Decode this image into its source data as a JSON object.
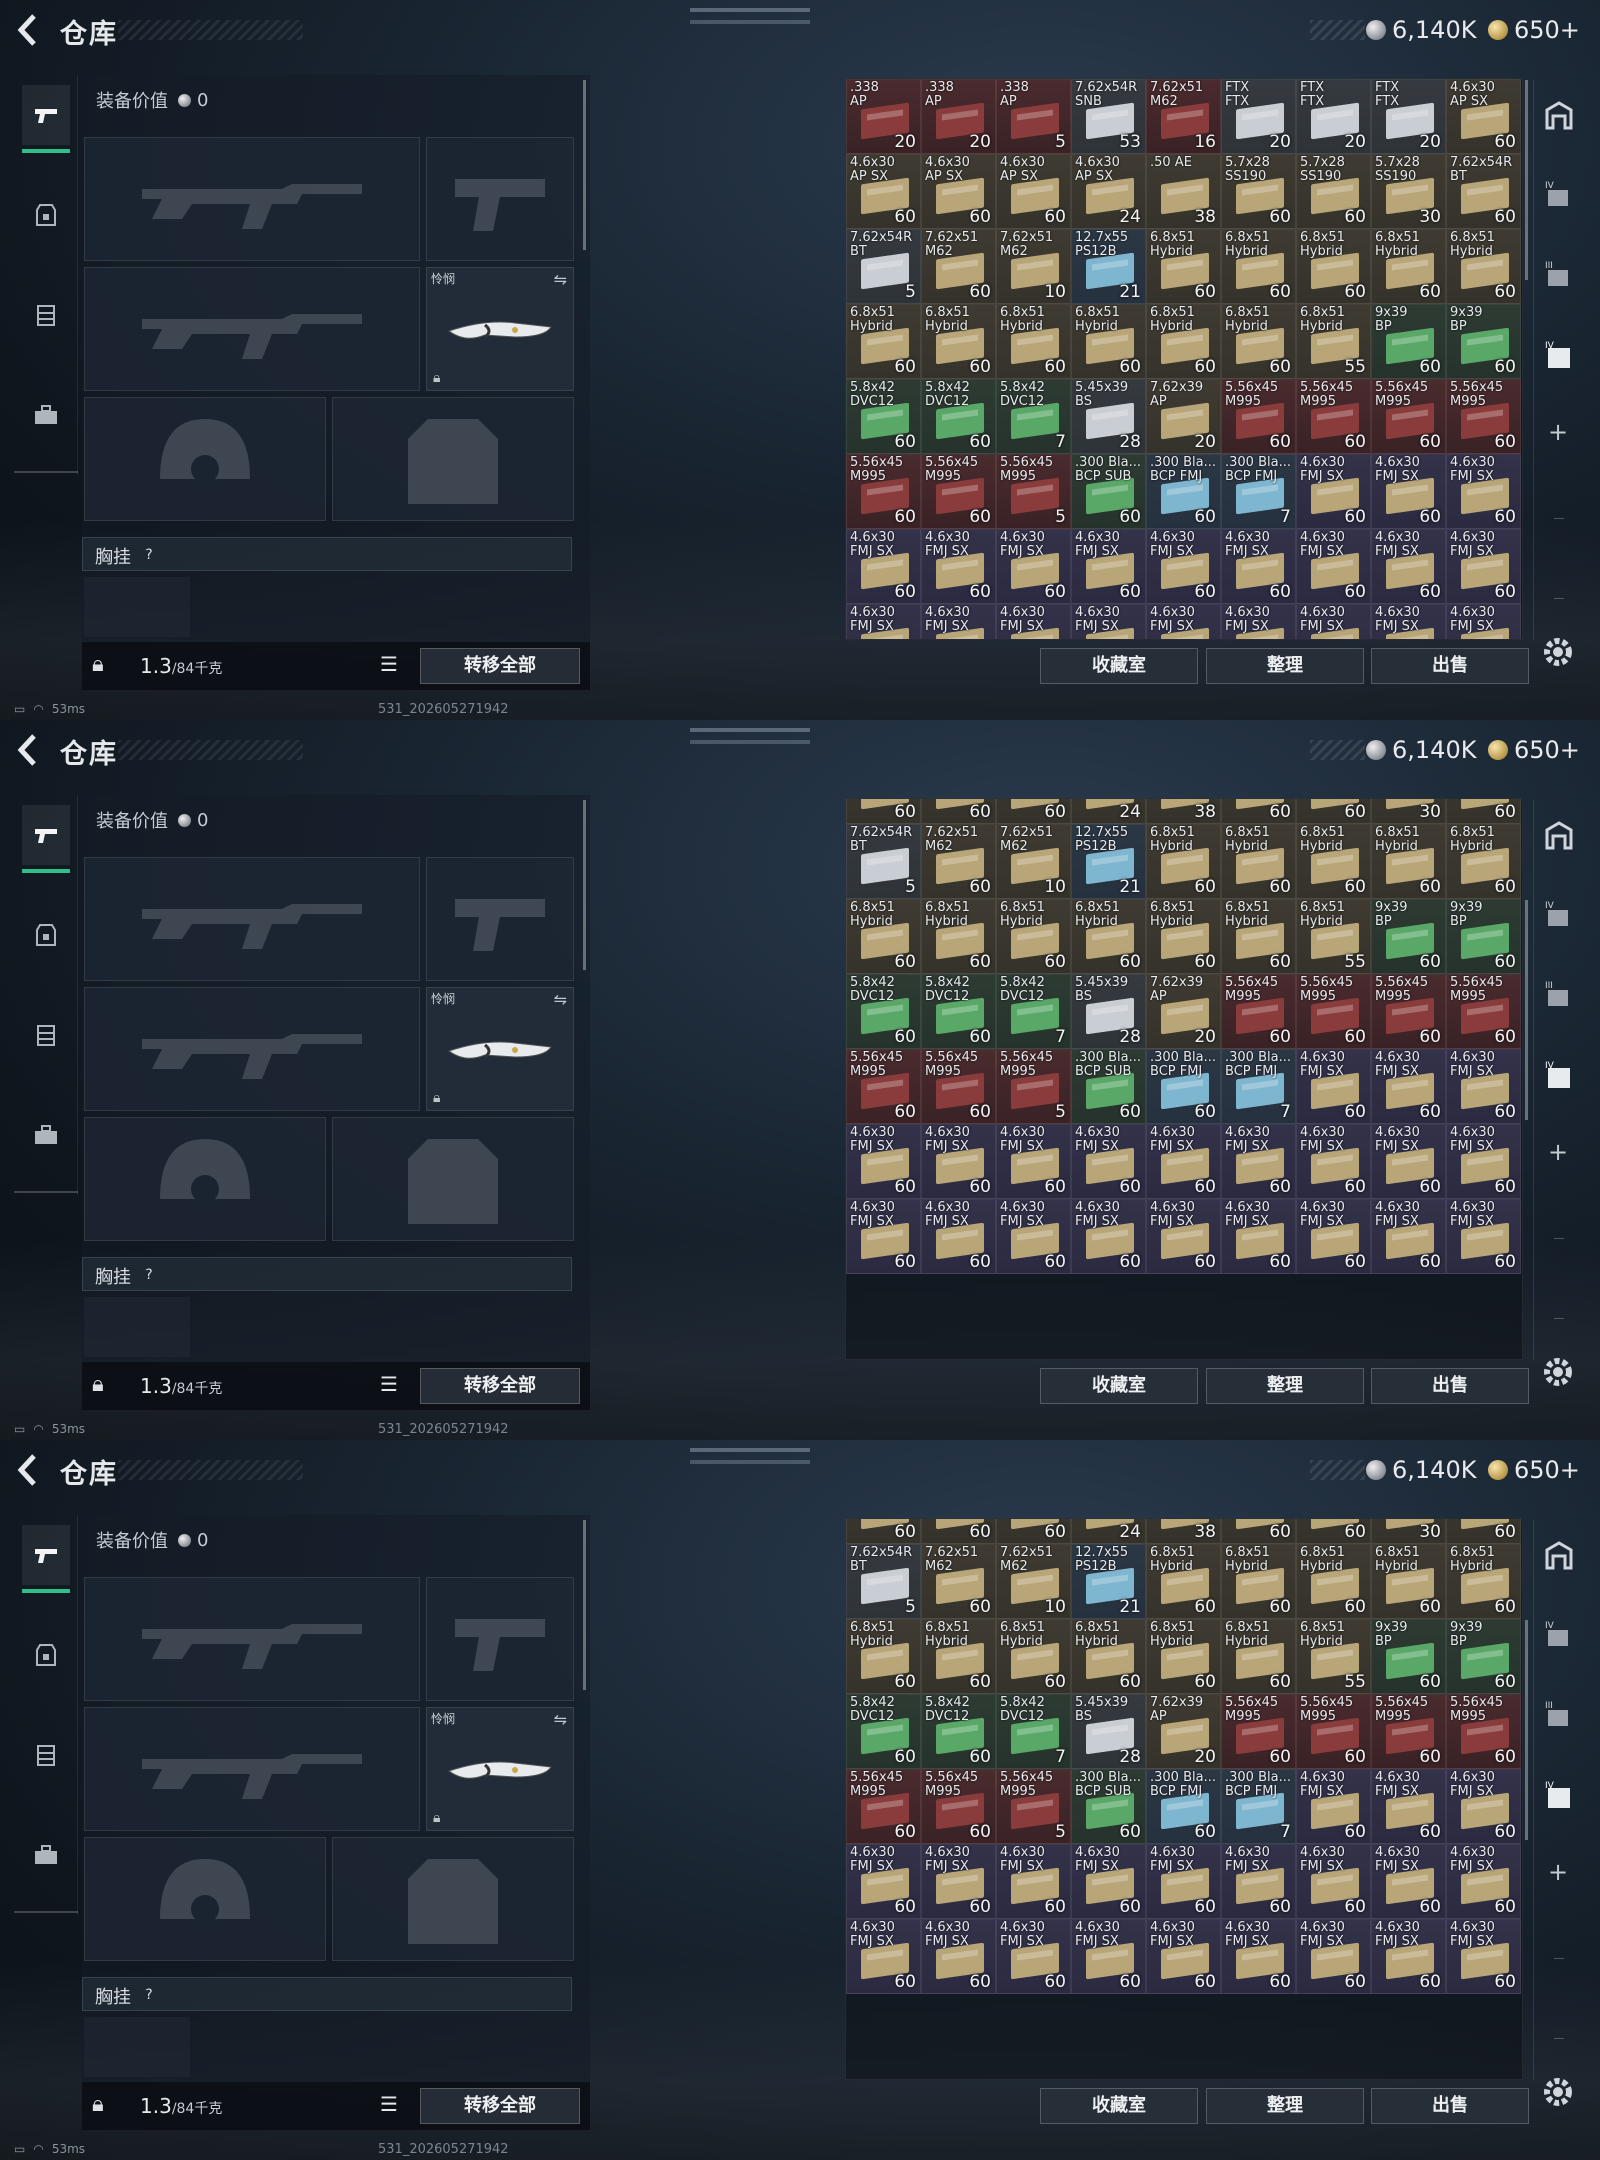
{
  "page": {
    "title": "仓库"
  },
  "currency": {
    "silver": "6,140K",
    "gold": "650+"
  },
  "loadout": {
    "value_label": "装备价值",
    "value": "0",
    "knife_label": "怜悯",
    "chest_label": "胸挂",
    "chest_help": "?",
    "weight": "1.3",
    "weight_max": "/84千克",
    "transfer_all": "转移全部"
  },
  "stash": {
    "collection": "收藏室",
    "sort": "整理",
    "sell": "出售"
  },
  "status": {
    "ping": "53ms",
    "build": "531_202605271942"
  },
  "rows": [
    [
      [
        "red",
        ".338",
        "AP",
        "20"
      ],
      [
        "red",
        ".338",
        "AP",
        "20"
      ],
      [
        "red",
        ".338",
        "AP",
        "5"
      ],
      [
        "g",
        "7.62x54R",
        "SNB",
        "53"
      ],
      [
        "red",
        "7.62x51",
        "M62",
        "16"
      ],
      [
        "g",
        "FTX",
        "FTX",
        "20"
      ],
      [
        "g",
        "FTX",
        "FTX",
        "20"
      ],
      [
        "g",
        "FTX",
        "FTX",
        "20"
      ],
      [
        "y",
        "4.6x30",
        "AP SX",
        "60"
      ]
    ],
    [
      [
        "y",
        "4.6x30",
        "AP SX",
        "60"
      ],
      [
        "y",
        "4.6x30",
        "AP SX",
        "60"
      ],
      [
        "y",
        "4.6x30",
        "AP SX",
        "60"
      ],
      [
        "y",
        "4.6x30",
        "AP SX",
        "24"
      ],
      [
        "y",
        ".50 AE",
        "",
        "38"
      ],
      [
        "y",
        "5.7x28",
        "SS190",
        "60"
      ],
      [
        "y",
        "5.7x28",
        "SS190",
        "60"
      ],
      [
        "y",
        "5.7x28",
        "SS190",
        "30"
      ],
      [
        "y",
        "7.62x54R",
        "BT",
        "60"
      ]
    ],
    [
      [
        "g",
        "7.62x54R",
        "BT",
        "5"
      ],
      [
        "y",
        "7.62x51",
        "M62",
        "60"
      ],
      [
        "y",
        "7.62x51",
        "M62",
        "10"
      ],
      [
        "b",
        "12.7x55",
        "PS12B",
        "21"
      ],
      [
        "y",
        "6.8x51",
        "Hybrid",
        "60"
      ],
      [
        "y",
        "6.8x51",
        "Hybrid",
        "60"
      ],
      [
        "y",
        "6.8x51",
        "Hybrid",
        "60"
      ],
      [
        "y",
        "6.8x51",
        "Hybrid",
        "60"
      ],
      [
        "y",
        "6.8x51",
        "Hybrid",
        "60"
      ]
    ],
    [
      [
        "y",
        "6.8x51",
        "Hybrid",
        "60"
      ],
      [
        "y",
        "6.8x51",
        "Hybrid",
        "60"
      ],
      [
        "y",
        "6.8x51",
        "Hybrid",
        "60"
      ],
      [
        "y",
        "6.8x51",
        "Hybrid",
        "60"
      ],
      [
        "y",
        "6.8x51",
        "Hybrid",
        "60"
      ],
      [
        "y",
        "6.8x51",
        "Hybrid",
        "60"
      ],
      [
        "y",
        "6.8x51",
        "Hybrid",
        "55"
      ],
      [
        "gr",
        "9x39",
        "BP",
        "60"
      ],
      [
        "gr",
        "9x39",
        "BP",
        "60"
      ]
    ],
    [
      [
        "gr",
        "5.8x42",
        "DVC12",
        "60"
      ],
      [
        "gr",
        "5.8x42",
        "DVC12",
        "60"
      ],
      [
        "gr",
        "5.8x42",
        "DVC12",
        "7"
      ],
      [
        "g",
        "5.45x39",
        "BS",
        "28"
      ],
      [
        "y",
        "7.62x39",
        "AP",
        "20"
      ],
      [
        "red",
        "5.56x45",
        "M995",
        "60"
      ],
      [
        "red",
        "5.56x45",
        "M995",
        "60"
      ],
      [
        "red",
        "5.56x45",
        "M995",
        "60"
      ],
      [
        "red",
        "5.56x45",
        "M995",
        "60"
      ]
    ],
    [
      [
        "red",
        "5.56x45",
        "M995",
        "60"
      ],
      [
        "red",
        "5.56x45",
        "M995",
        "60"
      ],
      [
        "red",
        "5.56x45",
        "M995",
        "5"
      ],
      [
        "gr",
        ".300 Bla...",
        "BCP SUB",
        "60"
      ],
      [
        "b",
        ".300 Bla...",
        "BCP FMJ",
        "60"
      ],
      [
        "b",
        ".300 Bla...",
        "BCP FMJ",
        "7"
      ],
      [
        "p",
        "4.6x30",
        "FMJ SX",
        "60"
      ],
      [
        "p",
        "4.6x30",
        "FMJ SX",
        "60"
      ],
      [
        "p",
        "4.6x30",
        "FMJ SX",
        "60"
      ]
    ],
    [
      [
        "p",
        "4.6x30",
        "FMJ SX",
        "60"
      ],
      [
        "p",
        "4.6x30",
        "FMJ SX",
        "60"
      ],
      [
        "p",
        "4.6x30",
        "FMJ SX",
        "60"
      ],
      [
        "p",
        "4.6x30",
        "FMJ SX",
        "60"
      ],
      [
        "p",
        "4.6x30",
        "FMJ SX",
        "60"
      ],
      [
        "p",
        "4.6x30",
        "FMJ SX",
        "60"
      ],
      [
        "p",
        "4.6x30",
        "FMJ SX",
        "60"
      ],
      [
        "p",
        "4.6x30",
        "FMJ SX",
        "60"
      ],
      [
        "p",
        "4.6x30",
        "FMJ SX",
        "60"
      ]
    ],
    [
      [
        "p",
        "4.6x30",
        "FMJ SX",
        "60"
      ],
      [
        "p",
        "4.6x30",
        "FMJ SX",
        "60"
      ],
      [
        "p",
        "4.6x30",
        "FMJ SX",
        "60"
      ],
      [
        "p",
        "4.6x30",
        "FMJ SX",
        "60"
      ],
      [
        "p",
        "4.6x30",
        "FMJ SX",
        "60"
      ],
      [
        "p",
        "4.6x30",
        "FMJ SX",
        "60"
      ],
      [
        "p",
        "4.6x30",
        "FMJ SX",
        "60"
      ],
      [
        "p",
        "4.6x30",
        "FMJ SX",
        "60"
      ],
      [
        "p",
        "4.6x30",
        "FMJ SX",
        "60"
      ]
    ]
  ],
  "colors": {
    "red": "#8a3b3b",
    "y": "#b8a678",
    "gr": "#5aa868",
    "b": "#7fb6cf",
    "p": "#b8a678",
    "g": "#c9ced4"
  },
  "frames": [
    {
      "first_row": 0,
      "rows": 8
    },
    {
      "first_row": 1,
      "rows": 7
    },
    {
      "first_row": 1,
      "rows": 7
    }
  ]
}
